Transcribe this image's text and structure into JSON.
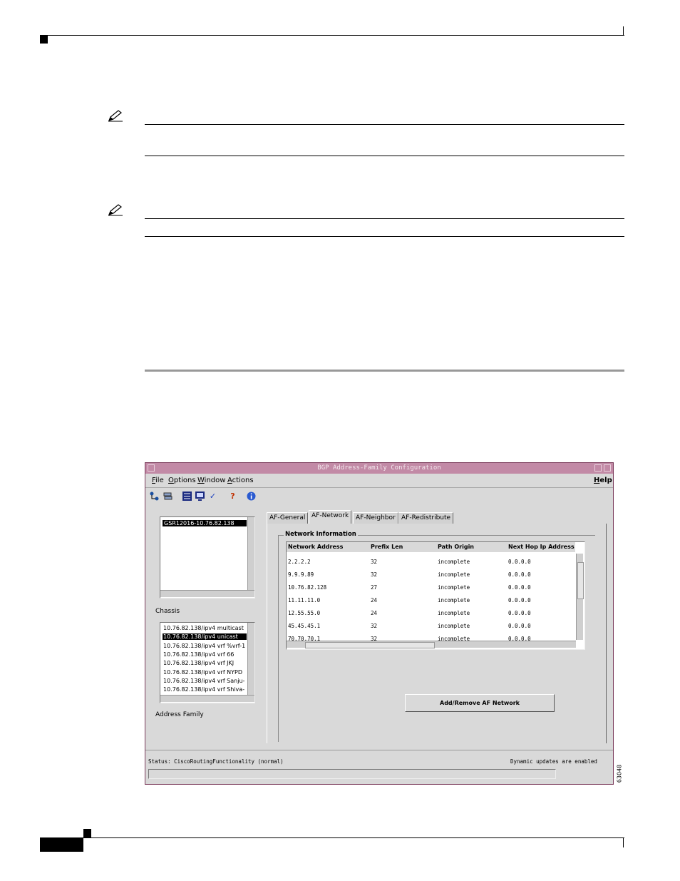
{
  "app_window": {
    "title": "BGP Address-Family Configuration",
    "menu": {
      "file": "File",
      "options": "Options",
      "window": "Window",
      "actions": "Actions",
      "help": "Help"
    },
    "chassis_list": {
      "items": [
        "GSR12016-10.76.82.138"
      ],
      "label": "Chassis"
    },
    "address_family_list": {
      "items": [
        "10.76.82.138/ipv4 multicast",
        "10.76.82.138/ipv4 unicast",
        "10.76.82.138/ipv4 vrf %vrf-1",
        "10.76.82.138/ipv4 vrf 66",
        "10.76.82.138/ipv4 vrf JKJ",
        "10.76.82.138/ipv4 vrf NYPD",
        "10.76.82.138/ipv4 vrf Sanju-",
        "10.76.82.138/ipv4 vrf Shiva-"
      ],
      "selected_index": 1,
      "label": "Address Family"
    },
    "tabs": [
      "AF-General",
      "AF-Network",
      "AF-Neighbor",
      "AF-Redistribute"
    ],
    "active_tab": "AF-Network",
    "group_title": "Network Information",
    "table": {
      "columns": [
        "Network Address",
        "Prefix Len",
        "Path Origin",
        "Next Hop Ip Address"
      ],
      "rows": [
        [
          "2.2.2.2",
          "32",
          "incomplete",
          "0.0.0.0"
        ],
        [
          "9.9.9.89",
          "32",
          "incomplete",
          "0.0.0.0"
        ],
        [
          "10.76.82.128",
          "27",
          "incomplete",
          "0.0.0.0"
        ],
        [
          "11.11.11.0",
          "24",
          "incomplete",
          "0.0.0.0"
        ],
        [
          "12.55.55.0",
          "24",
          "incomplete",
          "0.0.0.0"
        ],
        [
          "45.45.45.1",
          "32",
          "incomplete",
          "0.0.0.0"
        ],
        [
          "70.70.70.1",
          "32",
          "incomplete",
          "0.0.0.0"
        ]
      ]
    },
    "add_remove_button": "Add/Remove AF Network",
    "status_left": "Status: CiscoRoutingFunctionality (normal)",
    "status_right": "Dynamic updates are enabled"
  },
  "figure_number": "63048",
  "colors": {
    "title_bar": "#c28aa6",
    "selection": "#000000",
    "window_bg": "#d9d9d9"
  },
  "icons": [
    "note-pencil-icon",
    "toolbar-route-icon",
    "toolbar-layers-icon",
    "toolbar-list-icon",
    "toolbar-monitor-icon",
    "toolbar-check-icon",
    "toolbar-help-icon",
    "toolbar-info-icon"
  ]
}
